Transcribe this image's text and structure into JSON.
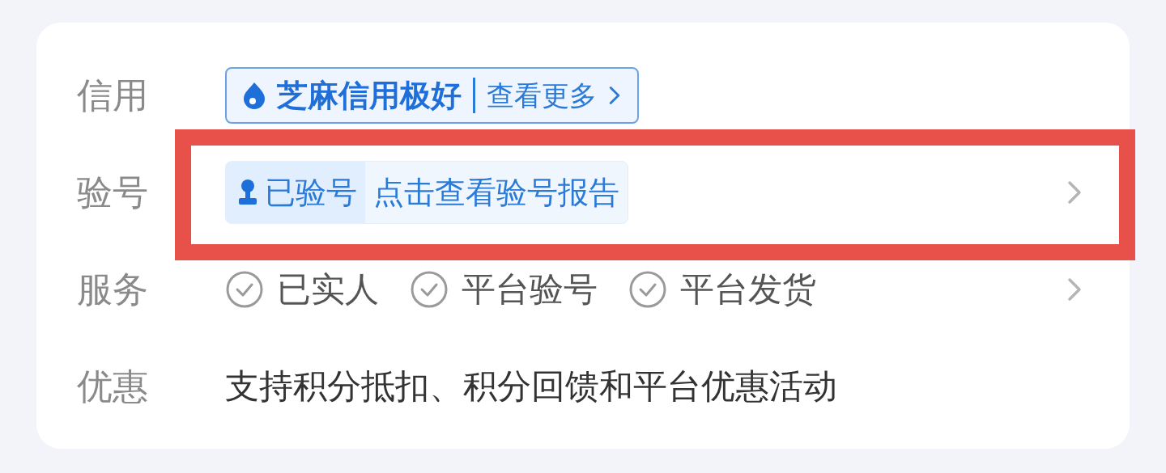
{
  "rows": [
    {
      "label": "信用",
      "kind": "credit",
      "title": "芝麻信用极好",
      "link": "查看更多"
    },
    {
      "label": "验号",
      "kind": "verify",
      "tag": "已验号",
      "link": "点击查看验号报告",
      "highlighted": true
    },
    {
      "label": "服务",
      "kind": "services",
      "items": [
        "已实人",
        "平台验号",
        "平台发货"
      ]
    },
    {
      "label": "优惠",
      "kind": "text",
      "text": "支持积分抵扣、积分回馈和平台优惠活动"
    }
  ]
}
